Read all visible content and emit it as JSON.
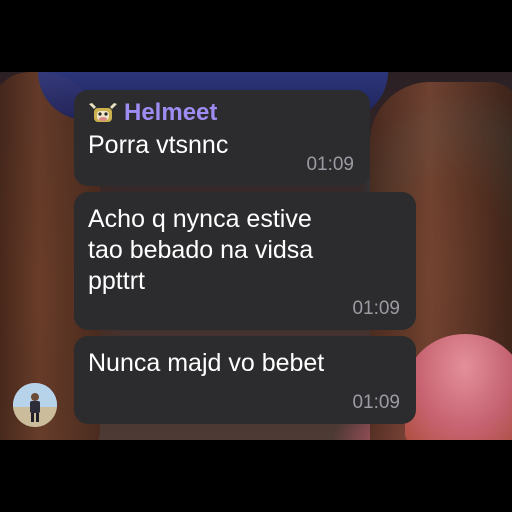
{
  "messages": [
    {
      "sender": "Helmeet",
      "sender_icon": "cow-icon",
      "text": "Porra vtsnnc",
      "time": "01:09"
    },
    {
      "text": "Acho q nynca estive\ntao bebado na vidsa\nppttrt",
      "time": "01:09"
    },
    {
      "text": "Nunca majd vo bebet",
      "time": "01:09"
    }
  ],
  "colors": {
    "bubble": "#2c2c2e",
    "sender_name": "#9f8cf2",
    "timestamp": "#9b9ba3",
    "text": "#ffffff"
  }
}
